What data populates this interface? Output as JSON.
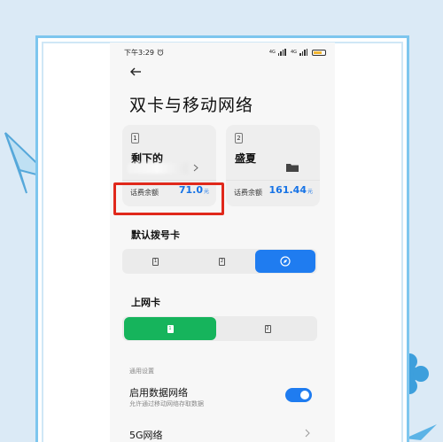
{
  "status_bar": {
    "time": "下午3:29",
    "alarm_icon": "alarm-clock-icon",
    "sim1_network": "4G",
    "sim2_network": "4G",
    "battery_icon": "battery-icon"
  },
  "header": {
    "back_icon": "back-arrow-icon",
    "title": "双卡与移动网络"
  },
  "sim_cards": [
    {
      "slot": "1",
      "name": "剩下的",
      "balance_label": "话费余额",
      "balance_value": "71.0",
      "balance_unit": "元"
    },
    {
      "slot": "2",
      "name": "盛夏",
      "balance_label": "话费余额",
      "balance_value": "161.44",
      "balance_unit": "元"
    }
  ],
  "default_dial": {
    "label": "默认拨号卡",
    "options": [
      "1",
      "2"
    ],
    "selected_icon": "compass-icon"
  },
  "data_card": {
    "label": "上网卡",
    "options": [
      "1",
      "2"
    ],
    "selected": "1"
  },
  "general": {
    "header": "通用设置",
    "data_network_title": "启用数据网络",
    "data_network_subtitle": "允许通过移动网络存取数据",
    "data_network_enabled": true,
    "fiveg_title": "5G网络"
  },
  "colors": {
    "accent_blue": "#1f7cf0",
    "accent_green": "#16b45c",
    "highlight_red": "#e0281b",
    "frame_blue": "#7dc6ee"
  }
}
